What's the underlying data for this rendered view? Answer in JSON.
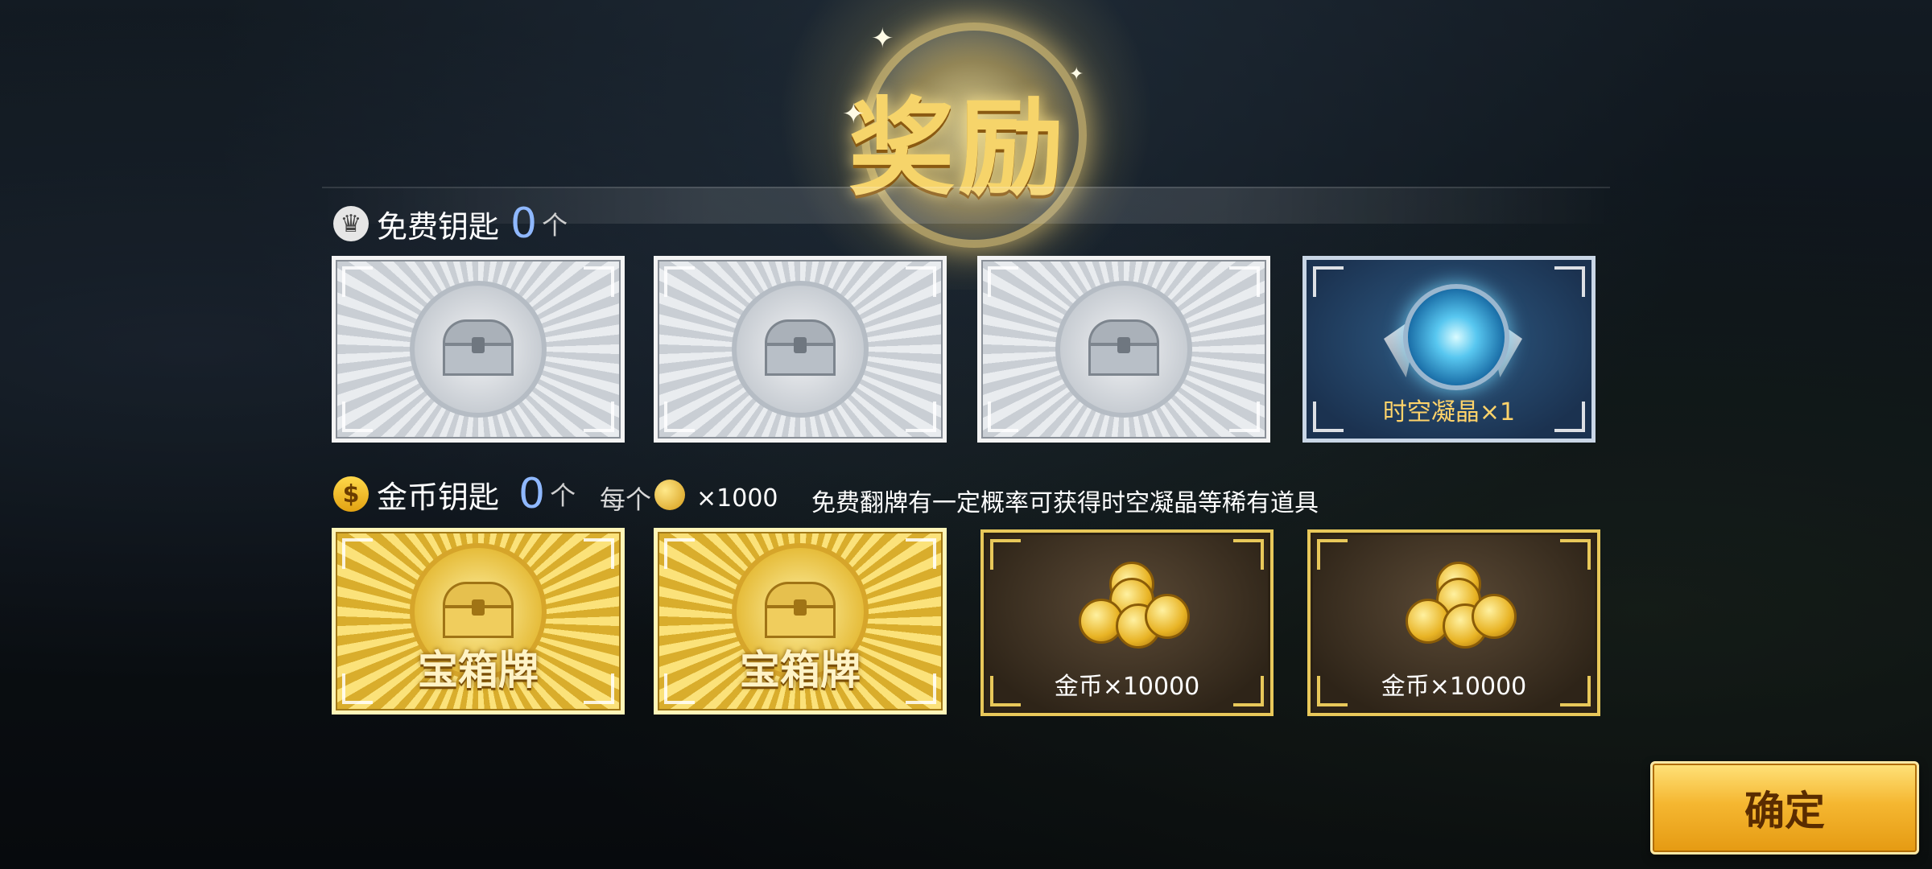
{
  "title": "奖励",
  "free_keys": {
    "label": "免费钥匙",
    "count": "0",
    "unit": "个",
    "cards": [
      {
        "type": "chest-silver"
      },
      {
        "type": "chest-silver"
      },
      {
        "type": "chest-silver"
      },
      {
        "type": "item",
        "caption": "时空凝晶×1"
      }
    ]
  },
  "gold_keys": {
    "label": "金币钥匙",
    "count": "0",
    "unit": "个",
    "cost_each": "每个",
    "cost_multiplier": "×1000",
    "notice": "免费翻牌有一定概率可获得时空凝晶等稀有道具",
    "cards": [
      {
        "type": "chest-gold",
        "caption": "宝箱牌"
      },
      {
        "type": "chest-gold",
        "caption": "宝箱牌"
      },
      {
        "type": "coins",
        "caption": "金币×10000"
      },
      {
        "type": "coins",
        "caption": "金币×10000"
      }
    ]
  },
  "confirm_label": "确定",
  "colors": {
    "accent_gold": "#f6d46a",
    "count_blue": "#8fb8ff"
  }
}
